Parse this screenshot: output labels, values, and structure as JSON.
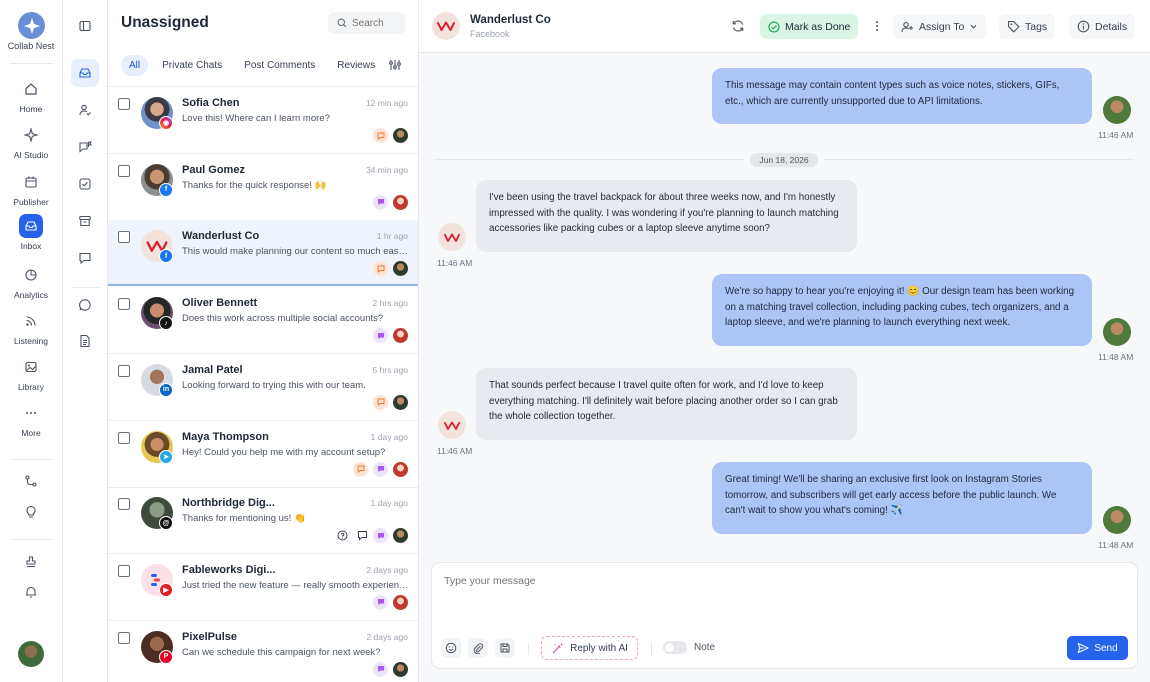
{
  "brand": {
    "name": "Collab Nest"
  },
  "rail": {
    "items": [
      {
        "label": "Home",
        "icon": "home-icon"
      },
      {
        "label": "AI Studio",
        "icon": "sparkle-icon"
      },
      {
        "label": "Publisher",
        "icon": "calendar-icon"
      },
      {
        "label": "Inbox",
        "icon": "inbox-icon"
      },
      {
        "label": "Analytics",
        "icon": "pie-chart-icon"
      },
      {
        "label": "Listening",
        "icon": "rss-icon"
      },
      {
        "label": "Library",
        "icon": "image-icon"
      },
      {
        "label": "More",
        "icon": "more-dots-icon"
      }
    ]
  },
  "list": {
    "title": "Unassigned",
    "search_placeholder": "Search",
    "filters": [
      "All",
      "Private Chats",
      "Post Comments",
      "Reviews"
    ],
    "conversations": [
      {
        "name": "Sofia Chen",
        "time": "12 min ago",
        "preview": "Love this! Where can I learn more?",
        "platform": "instagram",
        "type": "comment"
      },
      {
        "name": "Paul Gomez",
        "time": "34 min ago",
        "preview": "Thanks for the quick response! 🙌",
        "platform": "facebook",
        "type": "chat"
      },
      {
        "name": "Wanderlust Co",
        "time": "1 hr ago",
        "preview": "This would make planning our content so much easier",
        "platform": "facebook",
        "type": "comment"
      },
      {
        "name": "Oliver Bennett",
        "time": "2 hrs ago",
        "preview": "Does this work across multiple social accounts?",
        "platform": "tiktok",
        "type": "chat"
      },
      {
        "name": "Jamal Patel",
        "time": "5 hrs ago",
        "preview": "Looking forward to trying this with our team.",
        "platform": "linkedin",
        "type": "comment"
      },
      {
        "name": "Maya Thompson",
        "time": "1 day ago",
        "preview": "Hey! Could you help me with my account setup?",
        "platform": "telegram",
        "type": "both"
      },
      {
        "name": "Northbridge Dig...",
        "time": "1 day ago",
        "preview": "Thanks for mentioning us! 👏",
        "platform": "threads",
        "type": "chat"
      },
      {
        "name": "Fableworks Digi...",
        "time": "2 days ago",
        "preview": "Just tried the new feature — really smooth experience",
        "platform": "youtube",
        "type": "chat"
      },
      {
        "name": "PixelPulse",
        "time": "2 days ago",
        "preview": "Can we schedule this campaign for next week?",
        "platform": "pinterest",
        "type": "chat"
      }
    ]
  },
  "chat": {
    "contact_name": "Wanderlust Co",
    "contact_platform": "Facebook",
    "actions": {
      "mark_done": "Mark as Done",
      "assign": "Assign To",
      "tags": "Tags",
      "details": "Details"
    },
    "date_divider": "Jun 18, 2026",
    "messages": [
      {
        "dir": "out",
        "text": "This message may contain content types such as voice notes, stickers, GIFs, etc., which are currently unsupported due to API limitations.",
        "time": "11:46 AM"
      },
      {
        "dir": "in",
        "text": "I've been using the travel backpack for about three weeks now, and I'm honestly impressed with the quality. I was wondering if you're planning to launch matching accessories like packing cubes or a laptop sleeve anytime soon?",
        "time": "11:46 AM"
      },
      {
        "dir": "out",
        "text": "We're so happy to hear you're enjoying it! 😊 Our design team has been working on a matching travel collection, including packing cubes, tech organizers, and a laptop sleeve, and we're planning to launch everything next week.",
        "time": "11:48 AM"
      },
      {
        "dir": "in",
        "text": "That sounds perfect because I travel quite often for work, and I'd love to keep everything matching. I'll definitely wait before placing another order so I can grab the whole collection together.",
        "time": "11:46 AM"
      },
      {
        "dir": "out",
        "text": "Great timing! We'll be sharing an exclusive first look on Instagram Stories tomorrow, and subscribers will get early access before the public launch. We can't wait to show you what's coming! ✈️",
        "time": "11:48 AM"
      }
    ],
    "composer": {
      "placeholder": "Type your message",
      "ai_label": "Reply with AI",
      "note_label": "Note",
      "send_label": "Send"
    }
  },
  "colors": {
    "accent": "#2563eb",
    "outgoing_bubble": "#abc5f7",
    "incoming_bubble": "#e8eaef",
    "done_button": "#d9f5e6",
    "brand_red": "#d6232f"
  }
}
